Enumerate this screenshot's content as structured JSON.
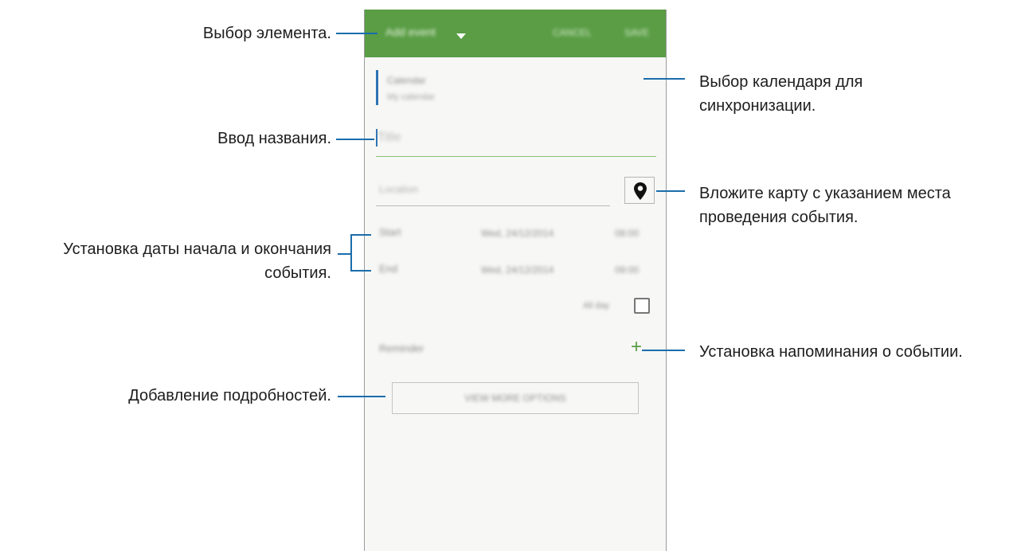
{
  "appbar": {
    "selector_label": "Add event",
    "cancel_label": "CANCEL",
    "save_label": "SAVE",
    "color": "#5a9d45"
  },
  "calendar": {
    "name": "Calendar",
    "account": "My calendar"
  },
  "form": {
    "title_placeholder": "Title",
    "location_placeholder": "Location",
    "start_label": "Start",
    "start_date": "Wed, 24/12/2014",
    "start_time": "08:00",
    "end_label": "End",
    "end_date": "Wed, 24/12/2014",
    "end_time": "09:00",
    "all_day_label": "All day",
    "all_day_checked": false,
    "reminder_label": "Reminder",
    "more_options_label": "VIEW MORE OPTIONS"
  },
  "icons": {
    "map": "map-pin-icon",
    "dropdown": "caret-down-icon",
    "add_reminder": "plus-icon"
  },
  "annotations": {
    "select_item": "Выбор элемента.",
    "calendar_line1": "Выбор календаря для",
    "calendar_line2": "синхронизации.",
    "enter_title": "Ввод названия.",
    "map_line1": "Вложите карту с указанием места",
    "map_line2": "проведения события.",
    "dates_line1": "Установка даты начала и окончания",
    "dates_line2": "события.",
    "reminder": "Установка напоминания о событии.",
    "details": "Добавление подробностей."
  },
  "colors": {
    "callout_line": "#1a6dab",
    "accent_green": "#5a9d45"
  }
}
